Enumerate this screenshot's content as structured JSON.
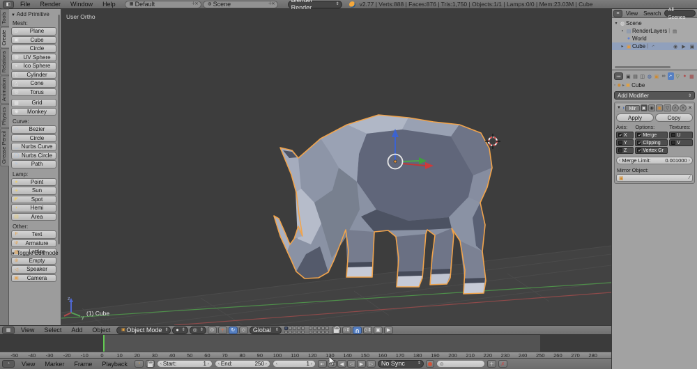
{
  "info_bar": {
    "menus": [
      "File",
      "Render",
      "Window",
      "Help"
    ],
    "layout_name": "Default",
    "scene_name": "Scene",
    "engine": "Blender Render",
    "stats": "v2.77 | Verts:888 | Faces:876 | Tris:1,750 | Objects:1/1 | Lamps:0/0 | Mem:23.03M | Cube"
  },
  "tool_tabs": [
    {
      "label": "Tools",
      "active": false
    },
    {
      "label": "Create",
      "active": true
    },
    {
      "label": "Relations",
      "active": false
    },
    {
      "label": "Animation",
      "active": false
    },
    {
      "label": "Physics",
      "active": false
    },
    {
      "label": "Grease Pencil",
      "active": false
    }
  ],
  "tool_shelf": {
    "panel_title": "Add Primitive",
    "footer_panel": "Toggle Editmode",
    "groups": [
      {
        "label": "Mesh:",
        "tint": "#e8e8e8",
        "items": [
          {
            "label": "Plane",
            "icon": "plane-icon"
          },
          {
            "label": "Cube",
            "icon": "cube-icon"
          },
          {
            "label": "Circle",
            "icon": "circle-icon"
          },
          {
            "label": "UV Sphere",
            "icon": "uv-sphere-icon"
          },
          {
            "label": "Ico Sphere",
            "icon": "ico-sphere-icon"
          },
          {
            "label": "Cylinder",
            "icon": "cylinder-icon"
          },
          {
            "label": "Cone",
            "icon": "cone-icon"
          },
          {
            "label": "Torus",
            "icon": "torus-icon"
          }
        ]
      },
      {
        "label": "",
        "tint": "#e8e8e8",
        "items": [
          {
            "label": "Grid",
            "icon": "grid-icon"
          },
          {
            "label": "Monkey",
            "icon": "monkey-icon"
          }
        ]
      },
      {
        "label": "Curve:",
        "tint": "#a9c2e0",
        "items": [
          {
            "label": "Bezier",
            "icon": "bezier-icon"
          },
          {
            "label": "Circle",
            "icon": "curve-circle-icon"
          },
          {
            "label": "Nurbs Curve",
            "icon": "nurbs-curve-icon"
          },
          {
            "label": "Nurbs Circle",
            "icon": "nurbs-circle-icon"
          },
          {
            "label": "Path",
            "icon": "path-icon"
          }
        ]
      },
      {
        "label": "Lamp:",
        "tint": "#e7cd76",
        "items": [
          {
            "label": "Point",
            "icon": "point-lamp-icon"
          },
          {
            "label": "Sun",
            "icon": "sun-icon"
          },
          {
            "label": "Spot",
            "icon": "spot-icon"
          },
          {
            "label": "Hemi",
            "icon": "hemi-icon"
          },
          {
            "label": "Area",
            "icon": "area-icon"
          }
        ]
      },
      {
        "label": "Other:",
        "tint": "#e2a65a",
        "items": [
          {
            "label": "Text",
            "icon": "text-icon"
          },
          {
            "label": "Armature",
            "icon": "armature-icon"
          },
          {
            "label": "Lattice",
            "icon": "lattice-icon"
          },
          {
            "label": "Empty",
            "icon": "empty-icon"
          },
          {
            "label": "Speaker",
            "icon": "speaker-icon"
          },
          {
            "label": "Camera",
            "icon": "camera-icon"
          }
        ]
      }
    ]
  },
  "viewport": {
    "view_label": "User Ortho",
    "active_object_label": "(1) Cube",
    "header": {
      "menus": [
        "View",
        "Select",
        "Add",
        "Object"
      ],
      "mode": "Object Mode",
      "orientation": "Global",
      "active_layer": 0
    }
  },
  "outliner": {
    "menus": [
      "View",
      "Search"
    ],
    "scenes_filter": "All Scenes",
    "tree": [
      {
        "label": "Scene",
        "icon": "scene-icon",
        "tint": "#e6e6e6",
        "indent": 0,
        "disc": "▾",
        "selected": false,
        "sub": "",
        "toggles": []
      },
      {
        "label": "RenderLayers",
        "icon": "renderlayers-icon",
        "tint": "#6f87b0",
        "indent": 1,
        "disc": "▪",
        "selected": false,
        "sub": "renderlayers-icon",
        "toggles": []
      },
      {
        "label": "World",
        "icon": "world-icon",
        "tint": "#5f7fd0",
        "indent": 1,
        "disc": "",
        "selected": false,
        "sub": "",
        "toggles": []
      },
      {
        "label": "Cube",
        "icon": "mesh-cube-icon",
        "tint": "#e69b3c",
        "indent": 1,
        "disc": "▸",
        "selected": true,
        "sub": "wrench-icon",
        "toggles": [
          "eye-icon",
          "pointer-icon",
          "camera-toggle-icon"
        ]
      }
    ]
  },
  "properties": {
    "tabs": [
      {
        "icon": "render-tab-icon",
        "tint": "#3c3c3c",
        "active": false
      },
      {
        "icon": "renderlayers-tab-icon",
        "tint": "#3c3c3c",
        "active": false
      },
      {
        "icon": "scene-tab-icon",
        "tint": "#3c3c3c",
        "active": false
      },
      {
        "icon": "world-tab-icon",
        "tint": "#3f5f9e",
        "active": false
      },
      {
        "icon": "object-tab-icon",
        "tint": "#d08a2e",
        "active": false
      },
      {
        "icon": "constraints-tab-icon",
        "tint": "#3c3c3c",
        "active": false
      },
      {
        "icon": "modifiers-tab-icon",
        "tint": "#ffffff",
        "active": true
      },
      {
        "icon": "data-tab-icon",
        "tint": "#4e7d46",
        "active": false
      },
      {
        "icon": "material-tab-icon",
        "tint": "#b05050",
        "active": false
      },
      {
        "icon": "texture-tab-icon",
        "tint": "#a04040",
        "active": false
      }
    ],
    "breadcrumb_object": "Cube",
    "add_modifier_label": "Add Modifier",
    "modifier": {
      "name": "Mir",
      "apply_label": "Apply",
      "copy_label": "Copy",
      "columns": [
        {
          "label": "Axis:",
          "items": [
            {
              "label": "X",
              "checked": true
            },
            {
              "label": "Y",
              "checked": false
            },
            {
              "label": "Z",
              "checked": false
            }
          ]
        },
        {
          "label": "Options:",
          "items": [
            {
              "label": "Merge",
              "checked": true
            },
            {
              "label": "Clipping",
              "checked": true
            },
            {
              "label": "Vertex Gr",
              "checked": true
            }
          ]
        },
        {
          "label": "Textures:",
          "items": [
            {
              "label": "U",
              "checked": false
            },
            {
              "label": "V",
              "checked": false
            }
          ]
        }
      ],
      "merge_limit_label": "Merge Limit:",
      "merge_limit_value": "0.001000",
      "mirror_object_label": "Mirror Object:"
    }
  },
  "timeline": {
    "menus": [
      "View",
      "Marker",
      "Frame",
      "Playback"
    ],
    "start_label": "Start:",
    "start_value": "1",
    "end_label": "End:",
    "end_value": "250",
    "current_frame": "1",
    "sync_mode": "No Sync",
    "ruler": {
      "min": -50,
      "max": 280,
      "step": 10,
      "frame_start": 1,
      "frame_end": 250
    },
    "playback": [
      "jump-to-start-icon",
      "jump-to-end-icon",
      "prev-keyframe-icon",
      "play-reverse-icon",
      "play-icon",
      "next-keyframe-icon"
    ]
  },
  "colors": {
    "accent_blue": "#5680c2",
    "selection_orange": "#f1a44c",
    "axis_x_red": "#c03737",
    "axis_y_green": "#4ca64c",
    "axis_z_blue": "#3c63d0",
    "record_red": "#d2543a",
    "current_frame_green": "#62c952"
  }
}
